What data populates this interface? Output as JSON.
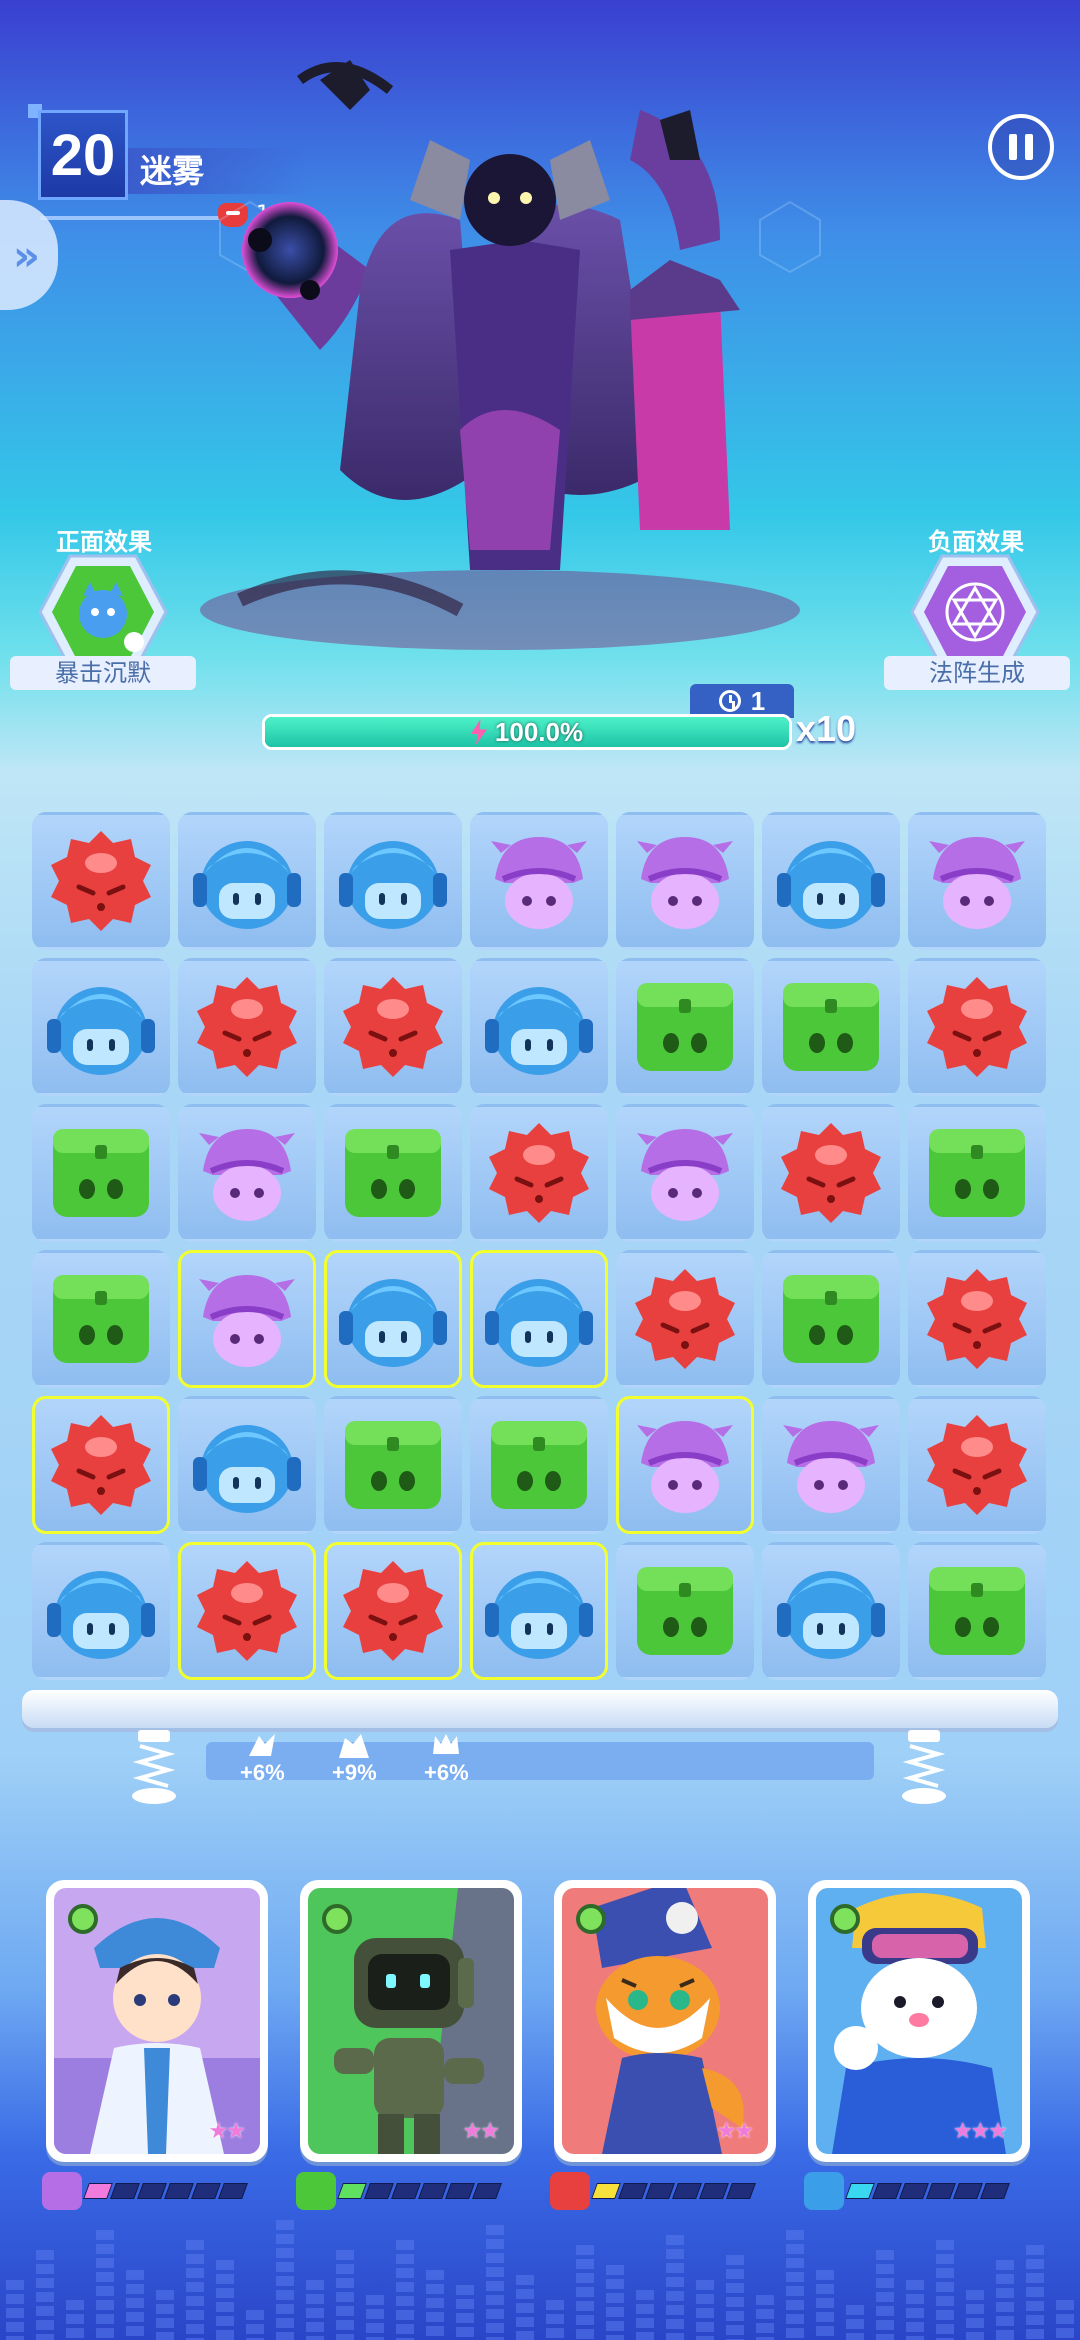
{
  "hud": {
    "level": "20",
    "stage_name": "迷雾",
    "enemy_count": "1/1"
  },
  "boss": {
    "icon": "shadow-wizard-boss-art"
  },
  "effects": {
    "positive_title": "正面效果",
    "positive_label": "暴击沉默",
    "positive_icon": "green-cat-hex-icon",
    "negative_title": "负面效果",
    "negative_label": "法阵生成",
    "negative_icon": "purple-magic-circle-hex-icon"
  },
  "energy": {
    "turns": "1",
    "percent_text": "100.0%",
    "fill_fraction": 1.0,
    "multiplier": "x10"
  },
  "board": {
    "rows": [
      [
        "red",
        "blue",
        "blue",
        "purple",
        "purple",
        "blue",
        "purple"
      ],
      [
        "blue",
        "red",
        "red",
        "blue",
        "green",
        "green",
        "red"
      ],
      [
        "green",
        "purple",
        "green",
        "red",
        "purple",
        "red",
        "green"
      ],
      [
        "green",
        "purple",
        "blue",
        "blue",
        "red",
        "green",
        "red"
      ],
      [
        "red",
        "blue",
        "green",
        "green",
        "purple",
        "purple",
        "red"
      ],
      [
        "blue",
        "red",
        "red",
        "blue",
        "green",
        "blue",
        "green"
      ]
    ],
    "selected": [
      [
        3,
        1
      ],
      [
        3,
        2
      ],
      [
        3,
        3
      ],
      [
        4,
        0
      ],
      [
        4,
        4
      ],
      [
        5,
        1
      ],
      [
        5,
        2
      ],
      [
        5,
        3
      ]
    ],
    "colors": {
      "red": "#e8403f",
      "blue": "#3a9ee8",
      "purple": "#b56ee6",
      "green": "#4cc73a"
    }
  },
  "bonuses": [
    {
      "text": "+6%",
      "icon": "warrior-bonus-icon"
    },
    {
      "text": "+9%",
      "icon": "beast-bonus-icon"
    },
    {
      "text": "+6%",
      "icon": "crown-bonus-icon"
    }
  ],
  "heroes": [
    {
      "name": "sage-hero",
      "stars": "★★",
      "bg": "#c7a8f0",
      "bar_color": "#f07bdd",
      "bar_icon_color": "#b56ee6",
      "energy_fraction": 0.15
    },
    {
      "name": "robot-hero",
      "stars": "★★",
      "bg": "#4fc65c",
      "bar_color": "#5fe05f",
      "bar_icon_color": "#4cc73a",
      "energy_fraction": 0.15
    },
    {
      "name": "tiger-hero",
      "stars": "★★",
      "bg": "#f07b7b",
      "bar_color": "#f6e23a",
      "bar_icon_color": "#e8403f",
      "energy_fraction": 0.15
    },
    {
      "name": "bear-pilot-hero",
      "stars": "★★★",
      "bg": "#5fb0f0",
      "bar_color": "#3ad8f0",
      "bar_icon_color": "#3a9ee8",
      "energy_fraction": 0.15
    }
  ]
}
